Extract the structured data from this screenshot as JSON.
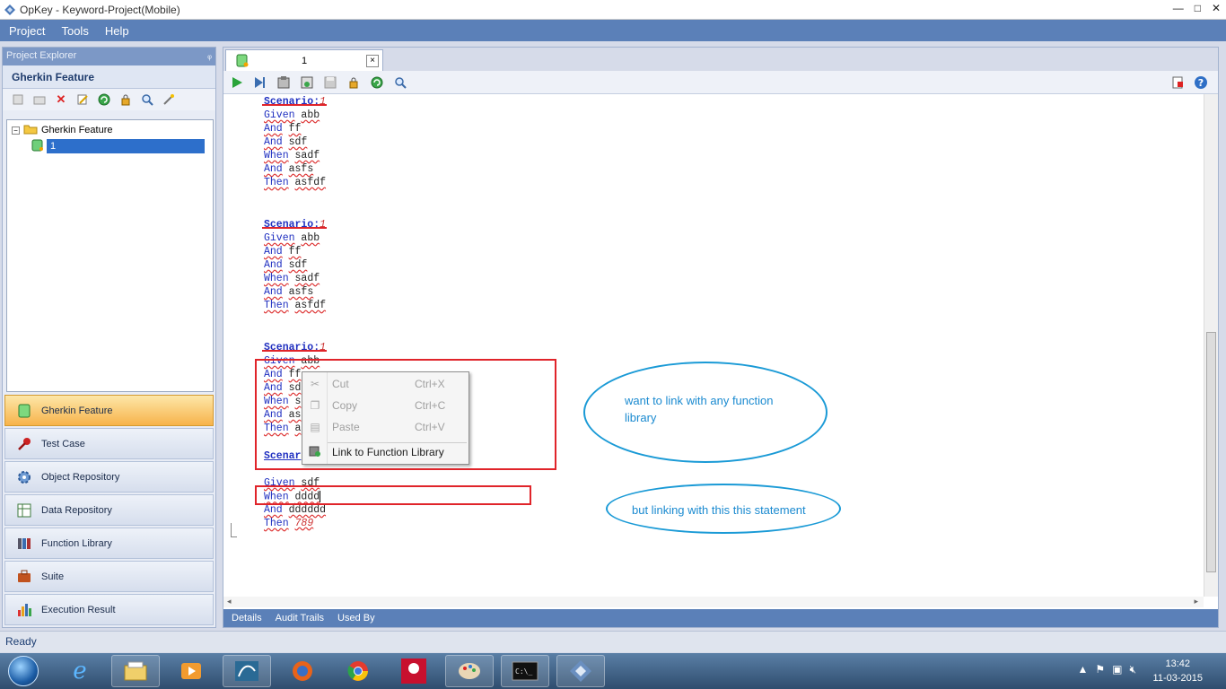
{
  "window": {
    "title": "OpKey - Keyword-Project(Mobile)",
    "minimize": "—",
    "maximize": "□",
    "close": "✕"
  },
  "menu": {
    "project": "Project",
    "tools": "Tools",
    "help": "Help"
  },
  "explorer": {
    "title": "Project Explorer",
    "pin": "ᵩ",
    "section": "Gherkin Feature",
    "tree": {
      "root": "Gherkin Feature",
      "child": "1"
    }
  },
  "nav": [
    "Gherkin Feature",
    "Test Case",
    "Object Repository",
    "Data Repository",
    "Function Library",
    "Suite",
    "Execution Result"
  ],
  "editor": {
    "tab_label": "1",
    "tab_close": "×",
    "lines": {
      "s1": "Scenario:",
      "s1n": "1",
      "g": "Given",
      "abb": "abb",
      "and": "And",
      "ff": "ff",
      "sdf": "sdf",
      "when": "When",
      "sadf": "sadf",
      "asfs": "asfs",
      "then": "Then",
      "asfdf": "asfdf",
      "scenario_cut": "Scenar",
      "given2": "Given",
      "sdf2": "sdf",
      "when2": "When",
      "dddd": "dddd",
      "and2": "And",
      "dddddd": "dddddd",
      "then2": "Then",
      "n789": "789",
      "trunc_and": "And",
      "trunc_ff": "ff",
      "trunc_sd": "sd",
      "trunc_when": "When",
      "trunc_s": "s",
      "trunc_as": "as",
      "trunc_then": "Then",
      "trunc_a": "a"
    }
  },
  "context_menu": {
    "cut": "Cut",
    "cut_key": "Ctrl+X",
    "copy": "Copy",
    "copy_key": "Ctrl+C",
    "paste": "Paste",
    "paste_key": "Ctrl+V",
    "link": "Link to Function Library"
  },
  "annotations": {
    "want": "want to link with any function library",
    "but": "but linking with this this statement"
  },
  "bottom_tabs": [
    "Details",
    "Audit Trails",
    "Used By"
  ],
  "status": "Ready",
  "clock": {
    "time": "13:42",
    "date": "11-03-2015"
  },
  "colors": {
    "accent": "#5b80b8",
    "annotation_red": "#e0242a",
    "annotation_blue": "#1a9ad6"
  }
}
